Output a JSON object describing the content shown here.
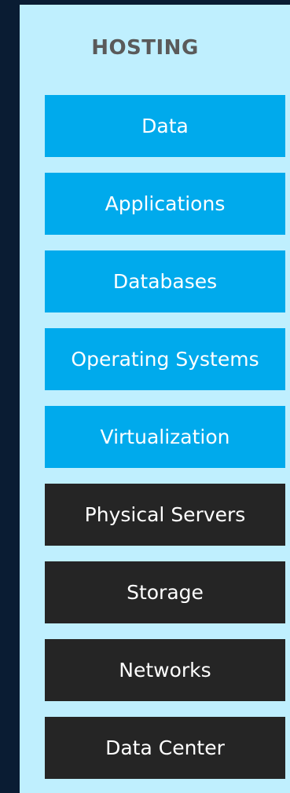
{
  "title": "HOSTING",
  "layers": [
    {
      "label": "Data",
      "group": "blue"
    },
    {
      "label": "Applications",
      "group": "blue"
    },
    {
      "label": "Databases",
      "group": "blue"
    },
    {
      "label": "Operating Systems",
      "group": "blue"
    },
    {
      "label": "Virtualization",
      "group": "blue"
    },
    {
      "label": "Physical Servers",
      "group": "dark"
    },
    {
      "label": "Storage",
      "group": "dark"
    },
    {
      "label": "Networks",
      "group": "dark"
    },
    {
      "label": "Data Center",
      "group": "dark"
    }
  ],
  "colors": {
    "background": "#0a1c33",
    "panel": "#bfeffe",
    "blue_layer": "#00aaec",
    "dark_layer": "#252525",
    "title_text": "#5a5a5a",
    "layer_text": "#ffffff"
  }
}
